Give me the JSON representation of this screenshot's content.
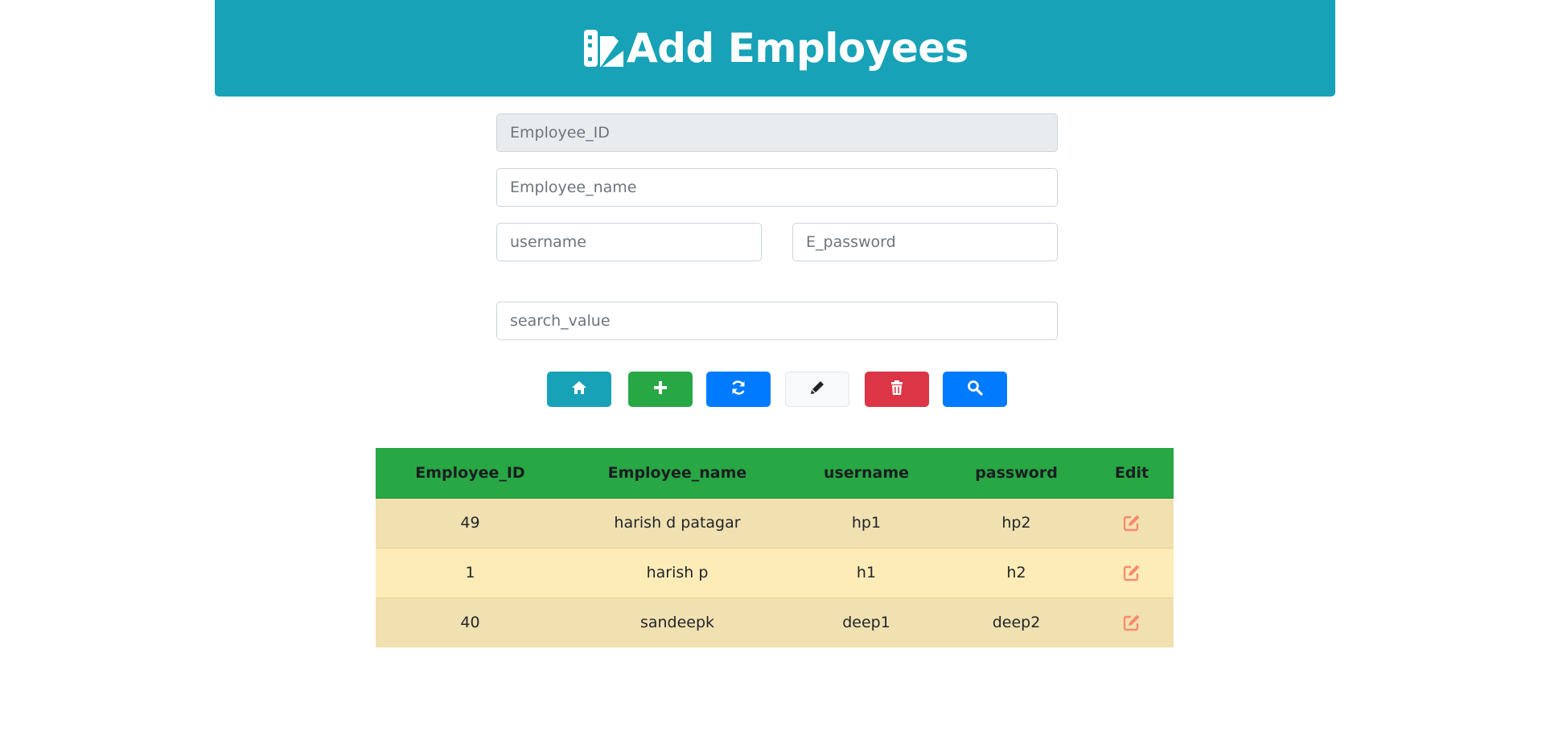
{
  "header": {
    "title": "Add Employees",
    "logo_icon": "database-pencil-icon"
  },
  "form": {
    "employee_id": {
      "placeholder": "Employee_ID",
      "value": ""
    },
    "employee_name": {
      "placeholder": "Employee_name",
      "value": ""
    },
    "username": {
      "placeholder": "username",
      "value": ""
    },
    "password": {
      "placeholder": "E_password",
      "value": ""
    },
    "search": {
      "placeholder": "search_value",
      "value": ""
    }
  },
  "toolbar": [
    {
      "name": "home-button",
      "icon": "home-icon",
      "color": "#17a2b8"
    },
    {
      "name": "add-button",
      "icon": "plus-icon",
      "color": "#28a745"
    },
    {
      "name": "refresh-button",
      "icon": "refresh-icon",
      "color": "#007bff"
    },
    {
      "name": "edit-button",
      "icon": "pencil-icon",
      "color": "#f8f9fa"
    },
    {
      "name": "delete-button",
      "icon": "trash-icon",
      "color": "#dc3545"
    },
    {
      "name": "search-button",
      "icon": "search-icon",
      "color": "#007bff"
    }
  ],
  "table": {
    "columns": [
      "Employee_ID",
      "Employee_name",
      "username",
      "password",
      "Edit"
    ],
    "rows": [
      {
        "id": "49",
        "name": "harish d patagar",
        "username": "hp1",
        "password": "hp2"
      },
      {
        "id": "1",
        "name": "harish p",
        "username": "h1",
        "password": "h2"
      },
      {
        "id": "40",
        "name": "sandeepk",
        "username": "deep1",
        "password": "deep2"
      }
    ],
    "edit_icon": "edit-icon",
    "edit_icon_color": "#fa8a6e",
    "header_color": "#28a745"
  }
}
